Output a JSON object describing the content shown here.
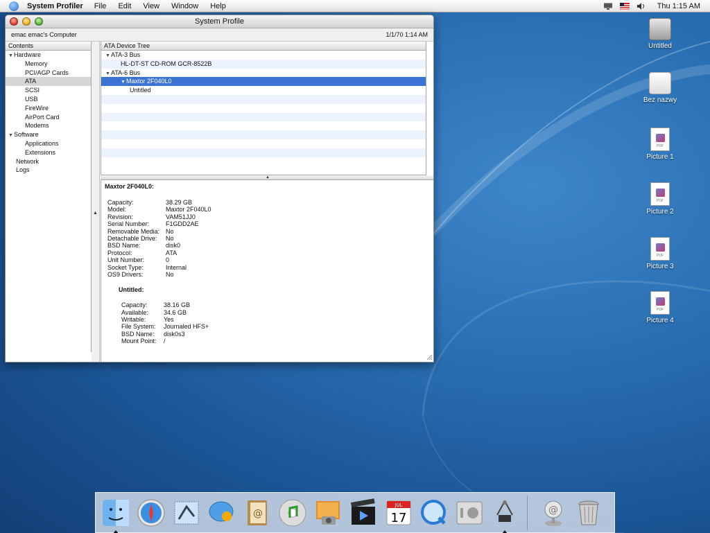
{
  "menubar": {
    "app_name": "System Profiler",
    "menus": [
      "File",
      "Edit",
      "View",
      "Window",
      "Help"
    ],
    "clock": "Thu 1:15 AM"
  },
  "window": {
    "title": "System Profile",
    "computer_name": "emac emac's Computer",
    "date": "1/1/70 1:14 AM",
    "contents_header": "Contents",
    "contents": [
      {
        "label": "Hardware",
        "type": "cat"
      },
      {
        "label": "Memory",
        "type": "sub"
      },
      {
        "label": "PCI/AGP Cards",
        "type": "sub"
      },
      {
        "label": "ATA",
        "type": "sub",
        "selected": true
      },
      {
        "label": "SCSI",
        "type": "sub"
      },
      {
        "label": "USB",
        "type": "sub"
      },
      {
        "label": "FireWire",
        "type": "sub"
      },
      {
        "label": "AirPort Card",
        "type": "sub"
      },
      {
        "label": "Modems",
        "type": "sub"
      },
      {
        "label": "Software",
        "type": "cat"
      },
      {
        "label": "Applications",
        "type": "sub"
      },
      {
        "label": "Extensions",
        "type": "sub"
      },
      {
        "label": "Network",
        "type": "top"
      },
      {
        "label": "Logs",
        "type": "top"
      }
    ],
    "tree_header": "ATA Device Tree",
    "tree": [
      {
        "label": "ATA-3 Bus",
        "level": 0,
        "expanded": true
      },
      {
        "label": "HL-DT-ST CD-ROM GCR-8522B",
        "level": 1
      },
      {
        "label": "ATA-6 Bus",
        "level": 0,
        "expanded": true
      },
      {
        "label": "Maxtor 2F040L0",
        "level": 1,
        "expanded": true,
        "selected": true
      },
      {
        "label": "Untitled",
        "level": 2
      }
    ],
    "detail": {
      "title": "Maxtor 2F040L0:",
      "properties": [
        {
          "k": "Capacity:",
          "v": "38.29 GB"
        },
        {
          "k": "Model:",
          "v": "Maxtor 2F040L0"
        },
        {
          "k": "Revision:",
          "v": "VAM51JJ0"
        },
        {
          "k": "Serial Number:",
          "v": "F1GDD2AE"
        },
        {
          "k": "Removable Media:",
          "v": "No"
        },
        {
          "k": "Detachable Drive:",
          "v": "No"
        },
        {
          "k": "BSD Name:",
          "v": "disk0"
        },
        {
          "k": "Protocol:",
          "v": "ATA"
        },
        {
          "k": "Unit Number:",
          "v": "0"
        },
        {
          "k": "Socket Type:",
          "v": "Internal"
        },
        {
          "k": "OS9 Drivers:",
          "v": "No"
        }
      ],
      "volume": {
        "title": "Untitled:",
        "properties": [
          {
            "k": "Capacity:",
            "v": "38.16 GB"
          },
          {
            "k": "Available:",
            "v": "34.6 GB"
          },
          {
            "k": "Writable:",
            "v": "Yes"
          },
          {
            "k": "File System:",
            "v": "Journaled HFS+"
          },
          {
            "k": "BSD Name:",
            "v": "disk0s3"
          },
          {
            "k": "Mount Point:",
            "v": "/"
          }
        ]
      }
    }
  },
  "desktop": [
    {
      "label": "Untitled",
      "icon": "hard-disk-icon"
    },
    {
      "label": "Bez nazwy",
      "icon": "white-disk-icon"
    },
    {
      "label": "Picture 1",
      "icon": "pdf-file-icon"
    },
    {
      "label": "Picture 2",
      "icon": "pdf-file-icon"
    },
    {
      "label": "Picture 3",
      "icon": "pdf-file-icon"
    },
    {
      "label": "Picture 4",
      "icon": "pdf-file-icon"
    }
  ],
  "pdf_badge": "PDF",
  "dock": {
    "calendar_month": "JUL",
    "calendar_day": "17",
    "items": [
      "finder-icon",
      "safari-icon",
      "mail-icon",
      "ichat-icon",
      "address-book-icon",
      "itunes-icon",
      "iphoto-icon",
      "imovie-icon",
      "ical-icon",
      "quicktime-icon",
      "system-preferences-icon",
      "system-profiler-icon",
      "internet-location-icon",
      "trash-icon"
    ]
  }
}
